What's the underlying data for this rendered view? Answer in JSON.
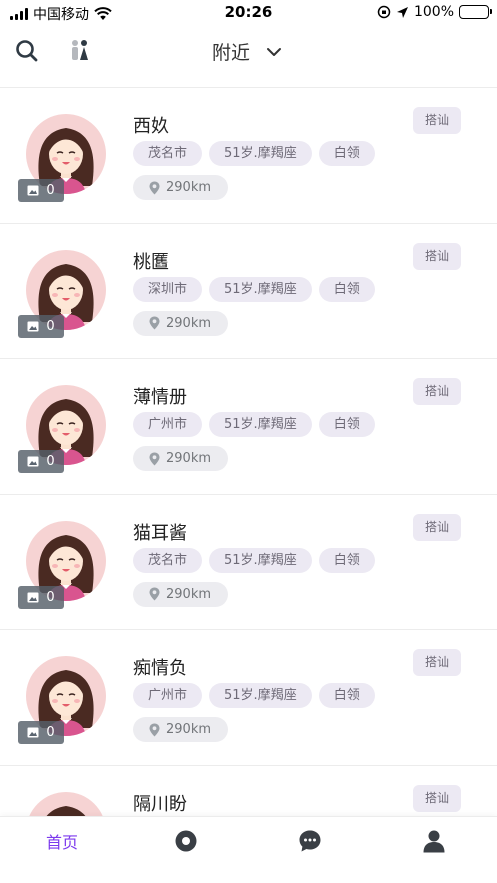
{
  "status_bar": {
    "carrier": "中国移动",
    "time": "20:26",
    "battery": "100%"
  },
  "nav": {
    "title": "附近",
    "icons": [
      "search-icon",
      "gender-filter-icon",
      "chevron-down-icon"
    ]
  },
  "users": [
    {
      "name": "西奺",
      "city": "茂名市",
      "age_sign": "51岁.摩羯座",
      "job": "白领",
      "distance": "290km",
      "photos": "0",
      "chat_label": "搭讪"
    },
    {
      "name": "桃匶",
      "city": "深圳市",
      "age_sign": "51岁.摩羯座",
      "job": "白领",
      "distance": "290km",
      "photos": "0",
      "chat_label": "搭讪"
    },
    {
      "name": "薄情册",
      "city": "广州市",
      "age_sign": "51岁.摩羯座",
      "job": "白领",
      "distance": "290km",
      "photos": "0",
      "chat_label": "搭讪"
    },
    {
      "name": "猫耳酱",
      "city": "茂名市",
      "age_sign": "51岁.摩羯座",
      "job": "白领",
      "distance": "290km",
      "photos": "0",
      "chat_label": "搭讪"
    },
    {
      "name": "痴情负",
      "city": "广州市",
      "age_sign": "51岁.摩羯座",
      "job": "白领",
      "distance": "290km",
      "photos": "0",
      "chat_label": "搭讪"
    },
    {
      "name": "隔川盼",
      "city": "",
      "age_sign": "",
      "job": "",
      "distance": "",
      "photos": "",
      "chat_label": "搭讪"
    }
  ],
  "tab_bar": {
    "home_label": "首页",
    "icons": [
      "discover-icon",
      "message-icon",
      "profile-icon"
    ],
    "active_color": "#7c3aed"
  },
  "colors": {
    "tag_bg": "#ece9f3",
    "tag_text": "#6e6a77",
    "avatar_bg": "#f6d3d3"
  }
}
